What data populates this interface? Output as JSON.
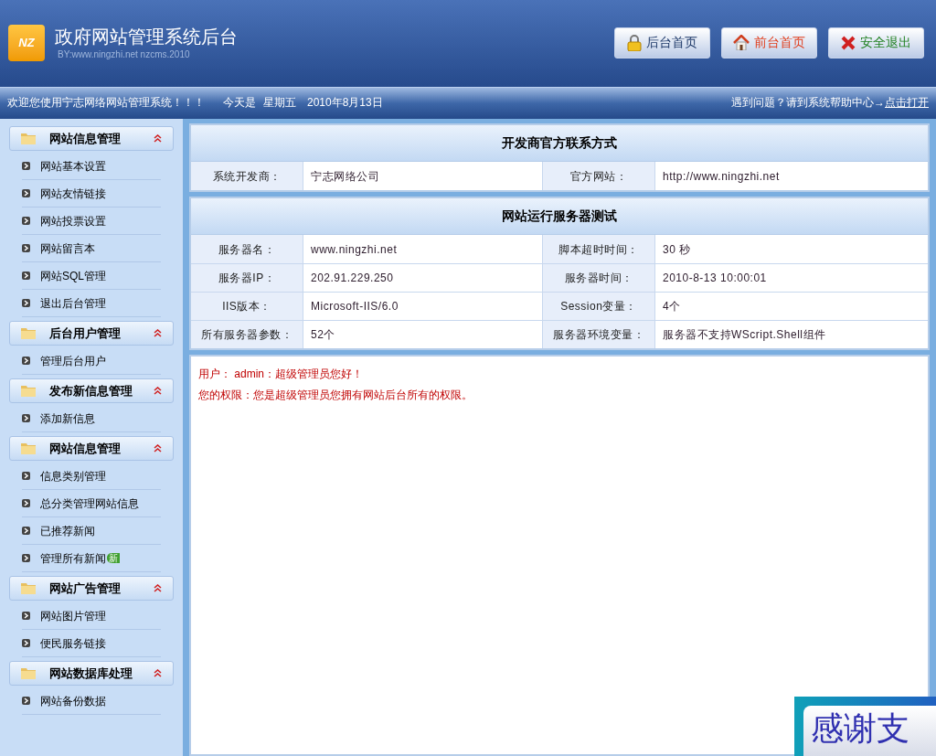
{
  "header": {
    "logo": "NZ",
    "title": "政府网站管理系统后台",
    "subtitle": "BY:www.ningzhi.net nzcms.2010",
    "buttons": [
      {
        "label": "后台首页",
        "kind": "lock"
      },
      {
        "label": "前台首页",
        "kind": "home"
      },
      {
        "label": "安全退出",
        "kind": "exit"
      }
    ]
  },
  "info_bar": {
    "welcome": "欢迎您使用宁志网络网站管理系统！！！",
    "today_label": "今天是",
    "weekday": "星期五",
    "date": "2010年8月13日",
    "help": "遇到问题？请到系统帮助中心→",
    "help_link": "点击打开"
  },
  "sidebar": {
    "groups": [
      {
        "title": "网站信息管理",
        "expanded": true,
        "items": [
          {
            "label": "网站基本设置"
          },
          {
            "label": "网站友情链接"
          },
          {
            "label": "网站投票设置"
          },
          {
            "label": "网站留言本"
          },
          {
            "label": "网站SQL管理"
          },
          {
            "label": "退出后台管理"
          }
        ]
      },
      {
        "title": "后台用户管理",
        "expanded": true,
        "items": [
          {
            "label": "管理后台用户"
          }
        ]
      },
      {
        "title": "发布新信息管理",
        "expanded": true,
        "items": [
          {
            "label": "添加新信息"
          }
        ]
      },
      {
        "title": "网站信息管理",
        "expanded": true,
        "items": [
          {
            "label": "信息类别管理"
          },
          {
            "label": "总分类管理网站信息"
          },
          {
            "label": "已推荐新闻"
          },
          {
            "label": "管理所有新闻",
            "badge": "新"
          }
        ]
      },
      {
        "title": "网站广告管理",
        "expanded": true,
        "items": [
          {
            "label": "网站图片管理"
          },
          {
            "label": "便民服务链接"
          }
        ]
      },
      {
        "title": "网站数据库处理",
        "expanded": true,
        "items": [
          {
            "label": "网站备份数据"
          }
        ]
      }
    ]
  },
  "panels": [
    {
      "title": "开发商官方联系方式",
      "rows": [
        [
          "系统开发商：",
          "宁志网络公司",
          "官方网站：",
          "http://www.ningzhi.net"
        ]
      ]
    },
    {
      "title": "网站运行服务器测试",
      "rows": [
        [
          "服务器名：",
          "www.ningzhi.net",
          "脚本超时时间：",
          "30 秒"
        ],
        [
          "服务器IP：",
          "202.91.229.250",
          "服务器时间：",
          "2010-8-13 10:00:01"
        ],
        [
          "IIS版本：",
          "Microsoft-IIS/6.0",
          "Session变量：",
          "4个"
        ],
        [
          "所有服务器参数：",
          "52个",
          "服务器环境变量：",
          "服务器不支持WScript.Shell组件"
        ]
      ]
    }
  ],
  "user_panel": {
    "greeting": "用户： admin：超级管理员您好！",
    "permission": "您的权限：您是超级管理员您拥有网站后台所有的权限。"
  },
  "popup": {
    "text": "感谢支"
  }
}
